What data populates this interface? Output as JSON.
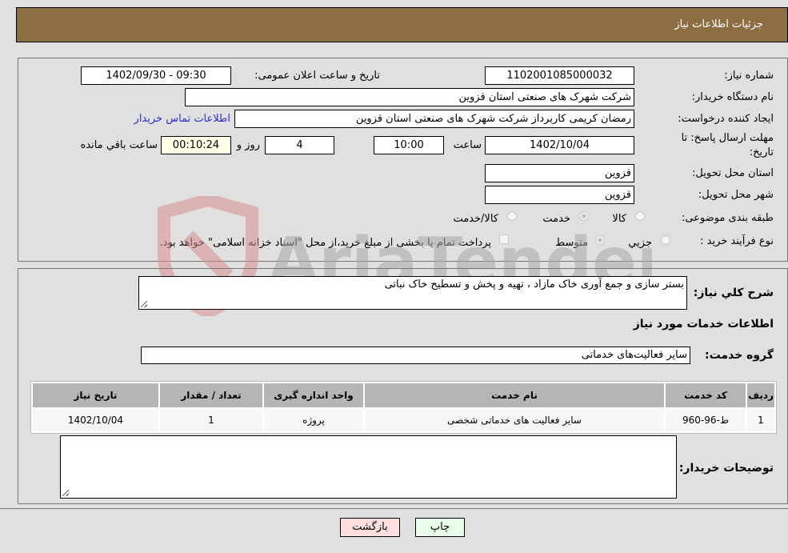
{
  "header": {
    "title": "جزئیات اطلاعات نیاز"
  },
  "form": {
    "need_number": {
      "label": "شماره نیاز:",
      "value": "1102001085000032"
    },
    "announce_datetime": {
      "label": "تاریخ و ساعت اعلان عمومی:",
      "value": "1402/09/30 - 09:30"
    },
    "buyer_org": {
      "label": "نام دستگاه خریدار:",
      "value": "شرکت شهرک های صنعتی استان قزوین"
    },
    "requester": {
      "label": "ایجاد کننده درخواست:",
      "value": "رمضان کریمی کاربرداز شرکت شهرک های صنعتی استان قزوین"
    },
    "buyer_contact_link": "اطلاعات تماس خریدار",
    "deadline": {
      "label_line1": "مهلت ارسال پاسخ: تا",
      "label_line2": "تاریخ:",
      "date": "1402/10/04",
      "time_label": "ساعت",
      "time": "10:00",
      "days": "4",
      "days_label": "روز و",
      "remaining": "00:10:24",
      "remaining_label": "ساعت باقي مانده"
    },
    "delivery_province": {
      "label": "استان محل تحویل:",
      "value": "قزوین"
    },
    "delivery_city": {
      "label": "شهر محل تحویل:",
      "value": "قزوین"
    },
    "category": {
      "label": "طبقه بندی موضوعی:",
      "options": [
        "کالا",
        "خدمت",
        "کالا/خدمت"
      ],
      "selected": "خدمت"
    },
    "purchase_process": {
      "label": "نوع فرآیند خرید :",
      "options": [
        "جزيي",
        "متوسط"
      ],
      "selected": "متوسط",
      "treasury_checkbox_label": "پرداخت تمام یا بخشی از مبلغ خرید،از محل \"اسناد خزانه اسلامی\" خواهد بود.",
      "treasury_checked": false
    }
  },
  "details": {
    "description_label": "شرح کلي نياز:",
    "description": "بستر سازی و جمع آوری خاک مازاد ، تهیه و پخش و تسطیح خاک نباتی",
    "services_title": "اطلاعات خدمات مورد نیاز",
    "service_group_label": "گروه خدمت:",
    "service_group": "سایر فعالیت‌های خدماتی",
    "table": {
      "headers": [
        "ردیف",
        "کد خدمت",
        "نام خدمت",
        "واحد اندازه گیری",
        "تعداد / مقدار",
        "تاریخ نیاز"
      ],
      "rows": [
        [
          "1",
          "ط-96-960",
          "سایر فعالیت های خدماتی شخصی",
          "پروژه",
          "1",
          "1402/10/04"
        ]
      ]
    },
    "buyer_notes_label": "توضیحات خریدار:",
    "buyer_notes": ""
  },
  "buttons": {
    "print": "چاپ",
    "back": "بازگشت"
  },
  "watermark": {
    "text": "AriaTender.neT"
  }
}
